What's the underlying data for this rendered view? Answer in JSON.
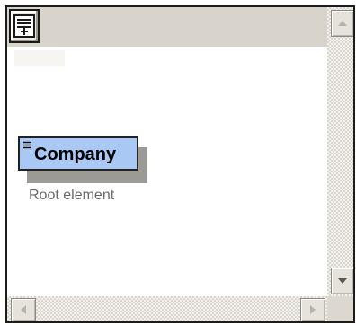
{
  "root_element": {
    "name": "Company",
    "annotation": "Root element"
  },
  "icons": {
    "corner_button": "overview-panel-icon",
    "element_marker": "element-contents-icon",
    "scroll_up": "triangle-up-icon",
    "scroll_down": "triangle-down-icon",
    "scroll_left": "triangle-left-icon",
    "scroll_right": "triangle-right-icon"
  },
  "colors": {
    "element_fill": "#a9c9f4",
    "element_border": "#222222",
    "annotation_text": "#6a6a6a",
    "chrome": "#d8d4cc"
  }
}
